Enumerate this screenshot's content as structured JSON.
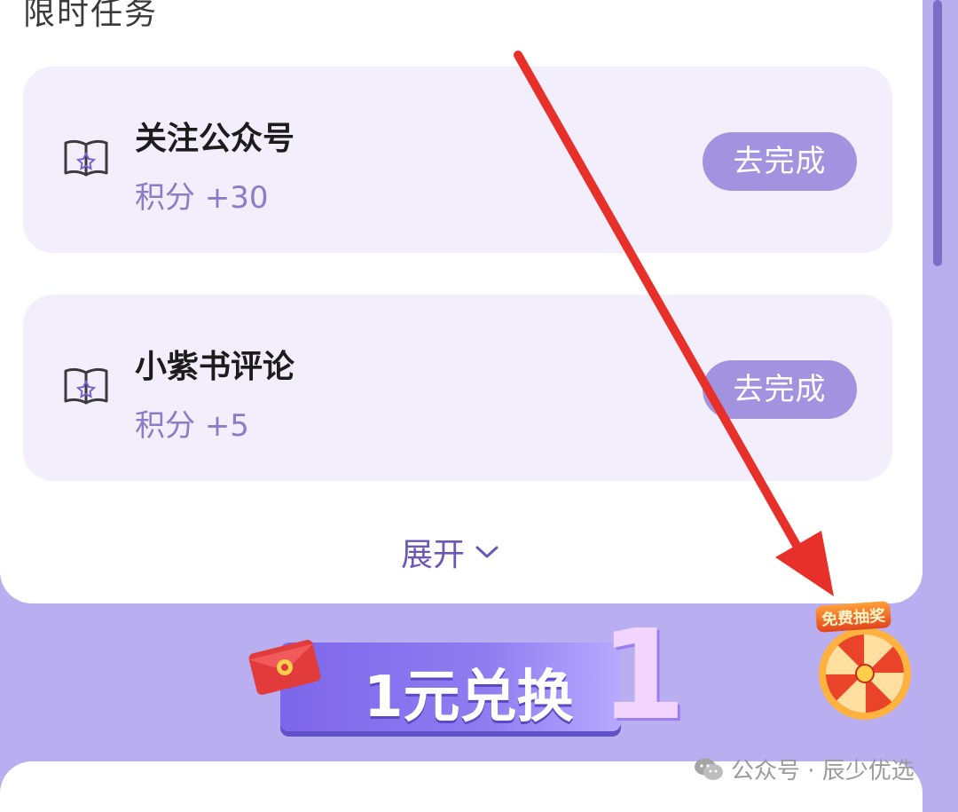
{
  "section_title": "限时任务",
  "tasks": [
    {
      "title": "关注公众号",
      "points": "积分 +30",
      "button": "去完成",
      "icon": "book-star-icon"
    },
    {
      "title": "小紫书评论",
      "points": "积分 +5",
      "button": "去完成",
      "icon": "book-star-icon"
    }
  ],
  "expand_label": "展开",
  "redeem": {
    "label": "1元兑换",
    "big_digit": "1"
  },
  "lottery": {
    "label": "免费抽奖"
  },
  "watermark": "公众号 · 辰少优选",
  "colors": {
    "accent": "#a293e0",
    "background": "#b8aef0",
    "card": "#f2eefb",
    "arrow": "#e8302a",
    "points_text": "#8b7cc6"
  }
}
